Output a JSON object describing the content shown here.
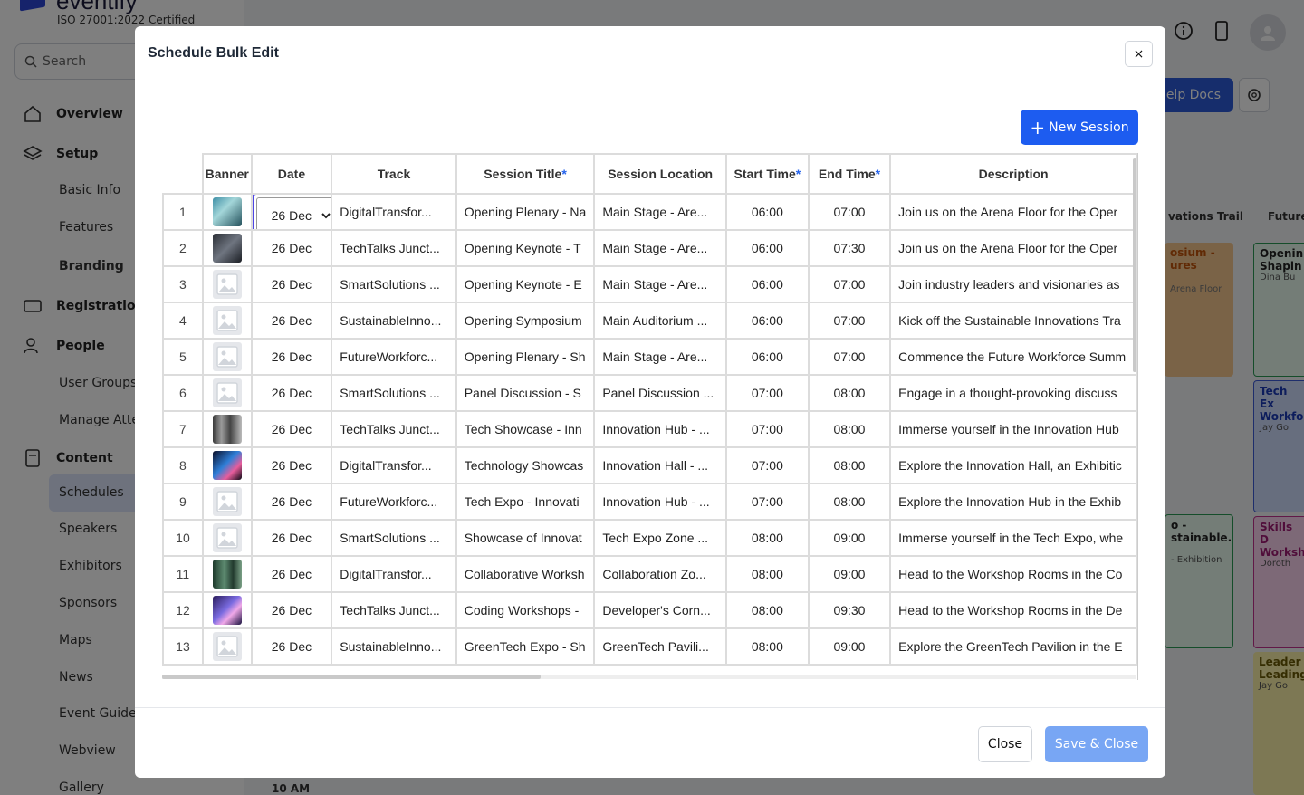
{
  "app": {
    "iso_label": "ISO 27001:2022 Certified",
    "logo_text": "eventify",
    "search_placeholder": "Search",
    "nav": [
      {
        "label": "Overview",
        "icon": "home-icon"
      },
      {
        "label": "Setup",
        "icon": "layers-icon"
      },
      {
        "label": "Registration",
        "icon": "ticket-icon"
      },
      {
        "label": "People",
        "icon": "users-icon"
      },
      {
        "label": "Content",
        "icon": "content-icon"
      }
    ],
    "sub_items": {
      "setup": [
        "Basic Info",
        "Features",
        "Branding"
      ],
      "people": [
        "User Groups",
        "Manage Atte"
      ],
      "content": [
        "Schedules",
        "Speakers",
        "Exhibitors",
        "Sponsors",
        "Maps",
        "News",
        "Event Guide",
        "Webview",
        "Gallery"
      ]
    },
    "help_docs": "elp Docs",
    "bg_columns": [
      "vations Trail",
      "Future"
    ],
    "bg_cards": [
      {
        "title": "osium - ures",
        "sub": "Arena Floor"
      },
      {
        "title": "Openin Shapin",
        "sub": "Dina Bu"
      },
      {
        "title": "Tech Ex Workfo",
        "sub": "Jay Go"
      },
      {
        "title": "o - stainable...",
        "sub": "- Exhibition"
      },
      {
        "title": "Skills D Worksh",
        "sub": "Doroth"
      },
      {
        "title": "Leader Leading",
        "sub": "Jay Go"
      }
    ],
    "bg_time": "10 AM"
  },
  "modal": {
    "title": "Schedule Bulk Edit",
    "close_icon_label": "×",
    "new_session_label": "New Session",
    "close_button": "Close",
    "save_button": "Save & Close",
    "columns": [
      "Banner",
      "Date",
      "Track",
      "Session Title",
      "Session Location",
      "Start Time",
      "End Time",
      "Description"
    ],
    "required_columns": [
      "Session Title",
      "Start Time",
      "End Time"
    ],
    "date_options": [
      "26 Dec"
    ],
    "rows": [
      {
        "n": "1",
        "banner": "image",
        "date": "26 Dec",
        "track": "DigitalTransfor...",
        "title": "Opening Plenary - Na",
        "location": "Main Stage - Are...",
        "start": "06:00",
        "end": "07:00",
        "desc": "Join us on the Arena Floor for the Oper"
      },
      {
        "n": "2",
        "banner": "image",
        "date": "26 Dec",
        "track": "TechTalks Junct...",
        "title": "Opening Keynote - T",
        "location": "Main Stage - Are...",
        "start": "06:00",
        "end": "07:30",
        "desc": "Join us on the Arena Floor for the Oper"
      },
      {
        "n": "3",
        "banner": "placeholder",
        "date": "26 Dec",
        "track": "SmartSolutions ...",
        "title": "Opening Keynote - E",
        "location": "Main Stage - Are...",
        "start": "06:00",
        "end": "07:00",
        "desc": "Join industry leaders and visionaries as"
      },
      {
        "n": "4",
        "banner": "placeholder",
        "date": "26 Dec",
        "track": "SustainableInno...",
        "title": "Opening Symposium",
        "location": "Main Auditorium ...",
        "start": "06:00",
        "end": "07:00",
        "desc": "Kick off the Sustainable Innovations Tra"
      },
      {
        "n": "5",
        "banner": "placeholder",
        "date": "26 Dec",
        "track": "FutureWorkforc...",
        "title": "Opening Plenary - Sh",
        "location": "Main Stage - Are...",
        "start": "06:00",
        "end": "07:00",
        "desc": "Commence the Future Workforce Summ"
      },
      {
        "n": "6",
        "banner": "placeholder",
        "date": "26 Dec",
        "track": "SmartSolutions ...",
        "title": "Panel Discussion - S",
        "location": "Panel Discussion ...",
        "start": "07:00",
        "end": "08:00",
        "desc": "Engage in a thought-provoking discuss"
      },
      {
        "n": "7",
        "banner": "image",
        "date": "26 Dec",
        "track": "TechTalks Junct...",
        "title": "Tech Showcase - Inn",
        "location": "Innovation Hub - ...",
        "start": "07:00",
        "end": "08:00",
        "desc": "Immerse yourself in the Innovation Hub"
      },
      {
        "n": "8",
        "banner": "image",
        "date": "26 Dec",
        "track": "DigitalTransfor...",
        "title": "Technology Showcas",
        "location": "Innovation Hall - ...",
        "start": "07:00",
        "end": "08:00",
        "desc": "Explore the Innovation Hall, an Exhibitic"
      },
      {
        "n": "9",
        "banner": "placeholder",
        "date": "26 Dec",
        "track": "FutureWorkforc...",
        "title": "Tech Expo - Innovati",
        "location": "Innovation Hub - ...",
        "start": "07:00",
        "end": "08:00",
        "desc": "Explore the Innovation Hub in the Exhib"
      },
      {
        "n": "10",
        "banner": "placeholder",
        "date": "26 Dec",
        "track": "SmartSolutions ...",
        "title": "Showcase of Innovat",
        "location": "Tech Expo Zone ...",
        "start": "08:00",
        "end": "09:00",
        "desc": "Immerse yourself in the Tech Expo, whe"
      },
      {
        "n": "11",
        "banner": "image",
        "date": "26 Dec",
        "track": "DigitalTransfor...",
        "title": "Collaborative Worksh",
        "location": "Collaboration Zo...",
        "start": "08:00",
        "end": "09:00",
        "desc": "Head to the Workshop Rooms in the Co"
      },
      {
        "n": "12",
        "banner": "image",
        "date": "26 Dec",
        "track": "TechTalks Junct...",
        "title": "Coding Workshops -",
        "location": "Developer's Corn...",
        "start": "08:00",
        "end": "09:30",
        "desc": "Head to the Workshop Rooms in the De"
      },
      {
        "n": "13",
        "banner": "placeholder",
        "date": "26 Dec",
        "track": "SustainableInno...",
        "title": "GreenTech Expo - Sh",
        "location": "GreenTech Pavili...",
        "start": "08:00",
        "end": "09:00",
        "desc": "Explore the GreenTech Pavilion in the E"
      }
    ]
  },
  "colors": {
    "primary": "#1d5cf0",
    "save_disabled": "#78a6f4",
    "focus_ring": "#4f46e5",
    "required_star": "#2563eb"
  }
}
